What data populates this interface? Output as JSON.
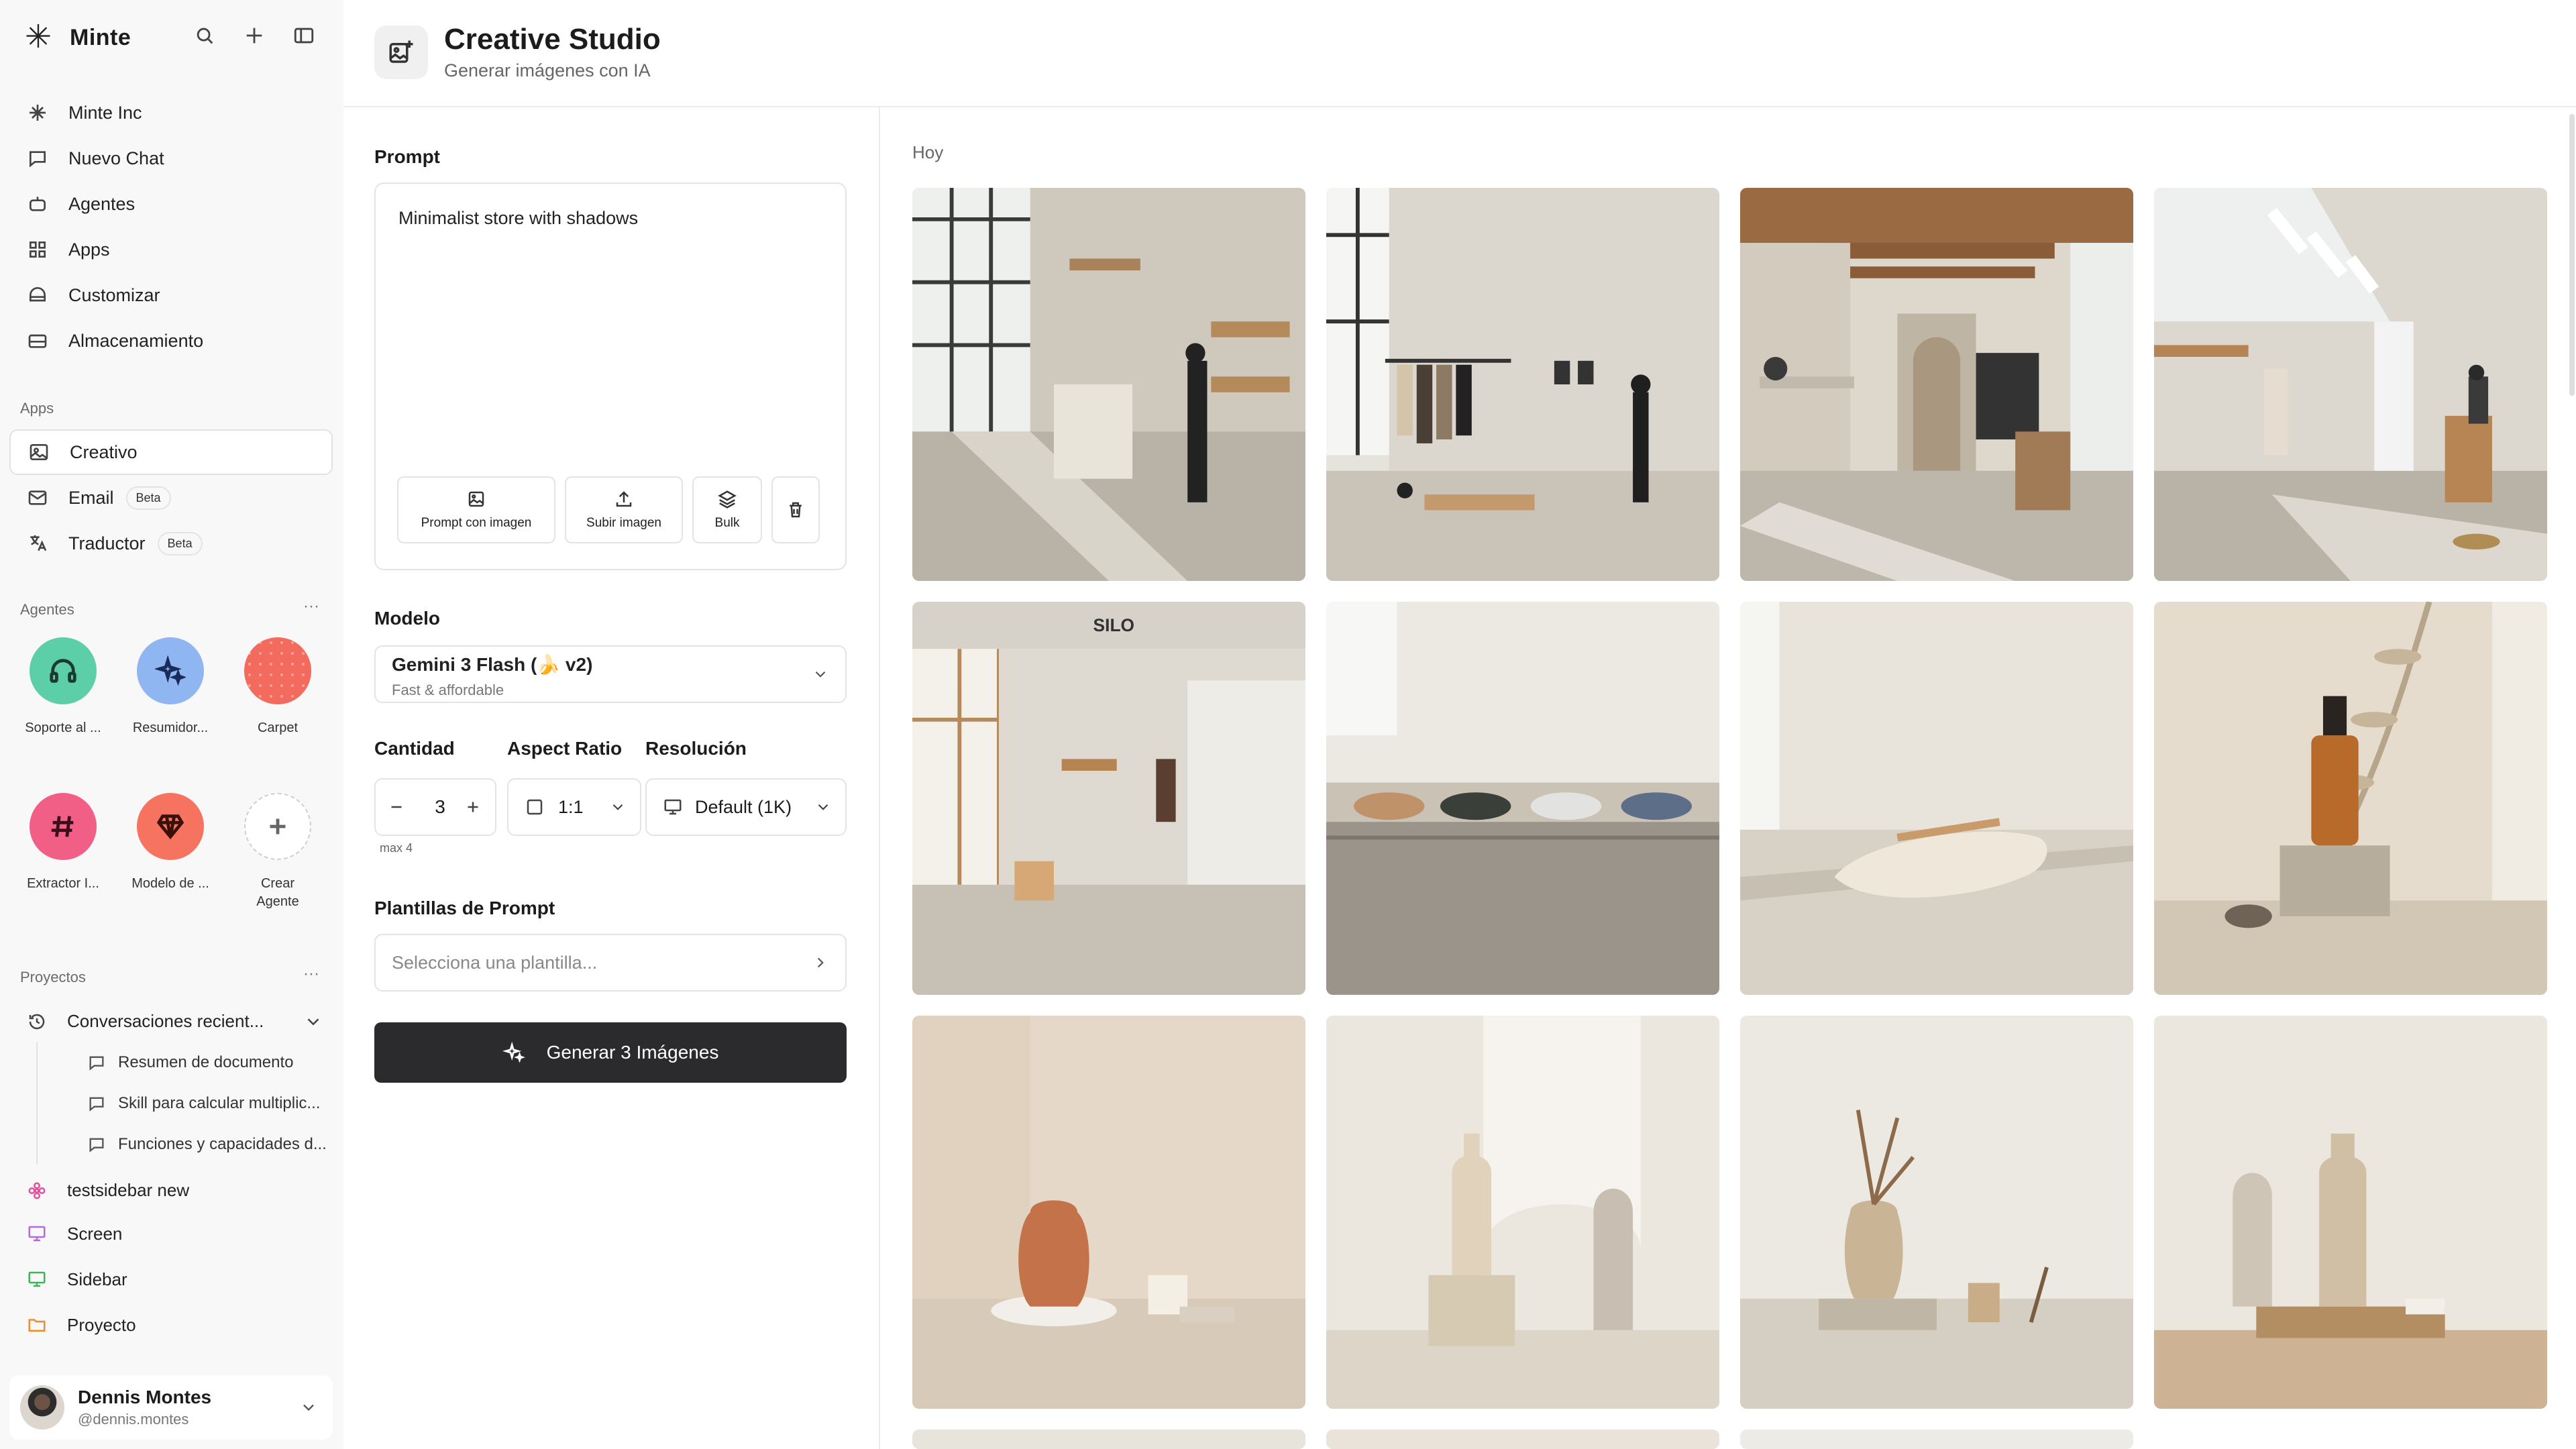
{
  "brand": {
    "name": "Minte",
    "logo_icon": "asterisk-logo-icon"
  },
  "nav": [
    {
      "label": "Minte Inc",
      "icon": "sparkle-icon"
    },
    {
      "label": "Nuevo Chat",
      "icon": "chat-icon"
    },
    {
      "label": "Agentes",
      "icon": "robot-icon"
    },
    {
      "label": "Apps",
      "icon": "grid-icon"
    },
    {
      "label": "Customizar",
      "icon": "palette-icon"
    },
    {
      "label": "Almacenamiento",
      "icon": "storage-icon"
    }
  ],
  "apps_section": {
    "label": "Apps",
    "items": [
      {
        "label": "Creativo",
        "icon": "image-icon",
        "active": true
      },
      {
        "label": "Email",
        "badge": "Beta",
        "icon": "mail-icon"
      },
      {
        "label": "Traductor",
        "badge": "Beta",
        "icon": "translate-icon"
      }
    ]
  },
  "agents_section": {
    "label": "Agentes",
    "more": "···",
    "items": [
      {
        "label": "Soporte al ...",
        "icon": "headphones-icon",
        "color": "#5ccfa8"
      },
      {
        "label": "Resumidor...",
        "icon": "sparkles-icon",
        "color": "#8fb6f0"
      },
      {
        "label": "Carpet",
        "icon": "dots-pattern-icon",
        "color": "#f36b5e"
      },
      {
        "label": "Extractor I...",
        "icon": "hash-icon",
        "color": "#f25f86"
      },
      {
        "label": "Modelo de ...",
        "icon": "diamond-icon",
        "color": "#f5735f"
      },
      {
        "label": "Crear\nAgente",
        "icon": "plus-icon",
        "color": "#ffffff"
      }
    ]
  },
  "projects_section": {
    "label": "Proyectos",
    "more": "···",
    "recent": {
      "label": "Conversaciones recient...",
      "icon": "history-icon"
    },
    "recent_items": [
      "Resumen de documento",
      "Skill para calcular multiplic...",
      "Funciones y capacidades d..."
    ],
    "items": [
      {
        "label": "testsidebar new",
        "icon": "flower-icon",
        "color": "#e0509f"
      },
      {
        "label": "Screen",
        "icon": "monitor-icon",
        "color": "#b46be0"
      },
      {
        "label": "Sidebar",
        "icon": "monitor-icon",
        "color": "#3cb55a"
      },
      {
        "label": "Proyecto",
        "icon": "folder-icon",
        "color": "#f28a2e"
      }
    ]
  },
  "user": {
    "name": "Dennis Montes",
    "handle": "@dennis.montes"
  },
  "header": {
    "title": "Creative Studio",
    "subtitle": "Generar imágenes con IA"
  },
  "form": {
    "prompt_label": "Prompt",
    "prompt_value": "Minimalist store with shadows",
    "prompt_buttons": [
      {
        "label": "Prompt con imagen",
        "icon": "image-add-icon"
      },
      {
        "label": "Subir imagen",
        "icon": "upload-icon"
      },
      {
        "label": "Bulk",
        "icon": "layers-icon"
      },
      {
        "label": "",
        "icon": "trash-icon"
      }
    ],
    "model_label": "Modelo",
    "model_name": "Gemini 3 Flash (🍌 v2)",
    "model_desc": "Fast & affordable",
    "quantity_label": "Cantidad",
    "quantity_value": "3",
    "quantity_max": "max 4",
    "aspect_label": "Aspect Ratio",
    "aspect_value": "1:1",
    "resolution_label": "Resolución",
    "resolution_value": "Default (1K)",
    "templates_label": "Plantillas de Prompt",
    "templates_placeholder": "Selecciona una plantilla...",
    "generate_label": "Generar 3 Imágenes"
  },
  "gallery": {
    "day_label": "Hoy",
    "images": [
      {
        "scene": "store-interior-windows",
        "silo_text": ""
      },
      {
        "scene": "clothing-rack-store",
        "silo_text": ""
      },
      {
        "scene": "store-corridor-skylight",
        "silo_text": ""
      },
      {
        "scene": "store-skylight-person",
        "silo_text": ""
      },
      {
        "scene": "silo-store",
        "silo_text": "SILO"
      },
      {
        "scene": "sneakers-shelf",
        "silo_text": ""
      },
      {
        "scene": "single-sneaker",
        "silo_text": ""
      },
      {
        "scene": "serum-bottle",
        "silo_text": ""
      },
      {
        "scene": "terracotta-vase",
        "silo_text": ""
      },
      {
        "scene": "bottle-arch-shadow",
        "silo_text": ""
      },
      {
        "scene": "vase-dried-flowers",
        "silo_text": ""
      },
      {
        "scene": "ceramic-bottle-wood",
        "silo_text": ""
      }
    ]
  }
}
